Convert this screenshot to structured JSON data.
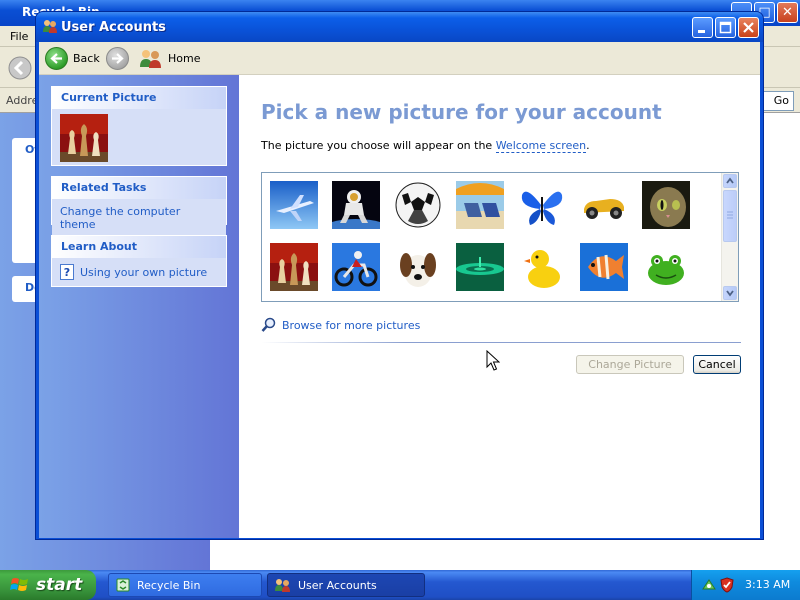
{
  "background_window": {
    "title": "Recycle Bin",
    "menu_file": "File",
    "address_label": "Address",
    "go_label": "Go",
    "panel_fragment_1": "Ot",
    "panel_fragment_2": "De"
  },
  "window": {
    "title": "User Accounts"
  },
  "navbar": {
    "back_label": "Back",
    "home_label": "Home"
  },
  "sidebar": {
    "current_picture": {
      "title": "Current Picture"
    },
    "related_tasks": {
      "title": "Related Tasks",
      "items": [
        "Change the computer theme"
      ]
    },
    "learn_about": {
      "title": "Learn About",
      "items": [
        "Using your own picture"
      ]
    }
  },
  "content": {
    "heading": "Pick a new picture for your account",
    "subtext_prefix": "The picture you choose will appear on the ",
    "subtext_link": "Welcome screen",
    "subtext_suffix": ".",
    "pictures": [
      "airplane",
      "astronaut",
      "soccer-ball",
      "beach-chairs",
      "butterfly",
      "car",
      "cat",
      "chess",
      "dirt-bike",
      "dog",
      "drip",
      "duck",
      "fish",
      "frog"
    ],
    "browse_label": "Browse for more pictures",
    "change_button": "Change Picture",
    "cancel_button": "Cancel"
  },
  "taskbar": {
    "start_label": "start",
    "tasks": [
      "Recycle Bin",
      "User Accounts"
    ],
    "clock": "3:13 AM"
  },
  "colors": {
    "title_blue": "#0a52d8",
    "link_blue": "#215dc6",
    "heading_blue": "#7b9ad3",
    "sidebar_blue": "#6375d6",
    "start_green": "#3c9a3c"
  }
}
